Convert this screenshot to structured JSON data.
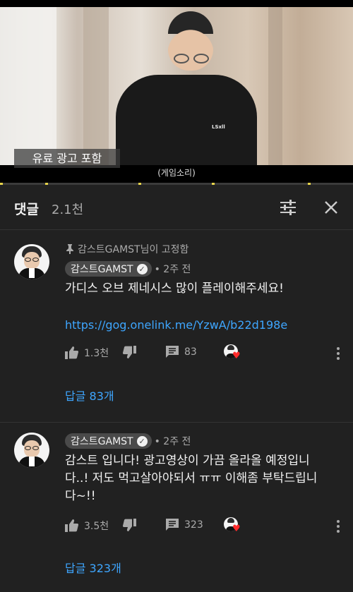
{
  "video": {
    "ad_badge": "유료 광고 포함",
    "caption": "(게임소리)",
    "shirt_text": "LSxll",
    "progress_color": "#e6d34a"
  },
  "comments_panel": {
    "title": "댓글",
    "count": "2.1천",
    "sort_icon": "sort-sliders-icon",
    "close_icon": "close-icon"
  },
  "comments": [
    {
      "pinned_label": "감스트GAMST님이 고정함",
      "author": "감스트GAMST",
      "time": "• 2주 전",
      "text": "가디스 오브 제네시스 많이 플레이해주세요!",
      "link": "https://gog.onelink.me/YzwA/b22d198e",
      "likes": "1.3천",
      "reply_count": "83",
      "replies_label": "답글 83개"
    },
    {
      "author": "감스트GAMST",
      "time": "• 2주 전",
      "text_lines": [
        "감스트 입니다! 광고영상이 가끔 올라올 예정입니",
        "다..! 저도 먹고살아야되서 ㅠㅠ 이해좀 부탁드립니",
        "다~!!"
      ],
      "likes": "3.5천",
      "reply_count": "323",
      "replies_label": "답글 323개"
    }
  ],
  "colors": {
    "panel_bg": "#212121",
    "link": "#3ea6ff",
    "secondary_text": "#aaaaaa",
    "heart": "#ff2a2a"
  }
}
